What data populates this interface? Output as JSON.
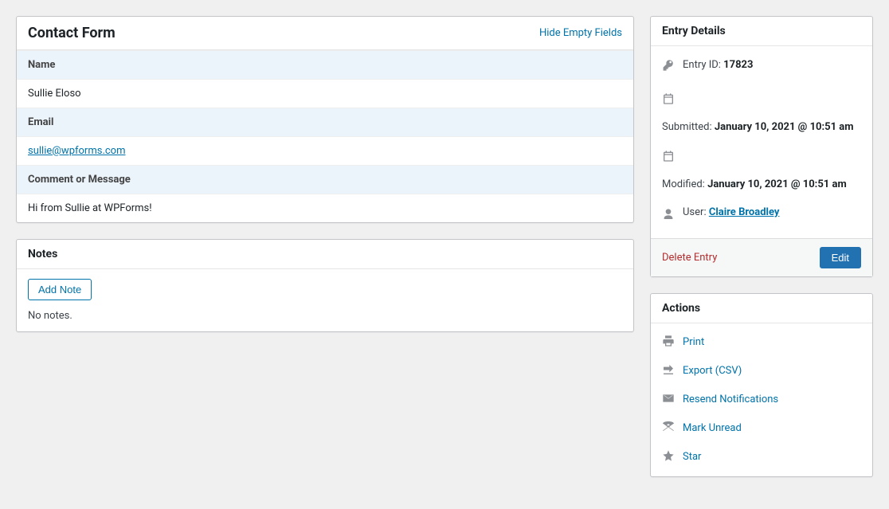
{
  "mainPanel": {
    "title": "Contact Form",
    "hideLink": "Hide Empty Fields",
    "fields": [
      {
        "label": "Name",
        "value": "Sullie Eloso",
        "isLink": false
      },
      {
        "label": "Email",
        "value": "sullie@wpforms.com",
        "isLink": true
      },
      {
        "label": "Comment or Message",
        "value": "Hi from Sullie at WPForms!",
        "isLink": false
      }
    ]
  },
  "notes": {
    "title": "Notes",
    "addNote": "Add Note",
    "empty": "No notes."
  },
  "details": {
    "title": "Entry Details",
    "entryIdLabel": "Entry ID:",
    "entryIdValue": "17823",
    "submittedLabel": "Submitted:",
    "submittedValue": "January 10, 2021 @ 10:51 am",
    "modifiedLabel": "Modified:",
    "modifiedValue": "January 10, 2021 @ 10:51 am",
    "userLabel": "User:",
    "userValue": "Claire Broadley",
    "deleteLabel": "Delete Entry",
    "editLabel": "Edit"
  },
  "actions": {
    "title": "Actions",
    "items": [
      {
        "label": "Print",
        "icon": "print"
      },
      {
        "label": "Export (CSV)",
        "icon": "export"
      },
      {
        "label": "Resend Notifications",
        "icon": "mail"
      },
      {
        "label": "Mark Unread",
        "icon": "unread"
      },
      {
        "label": "Star",
        "icon": "star"
      }
    ]
  }
}
